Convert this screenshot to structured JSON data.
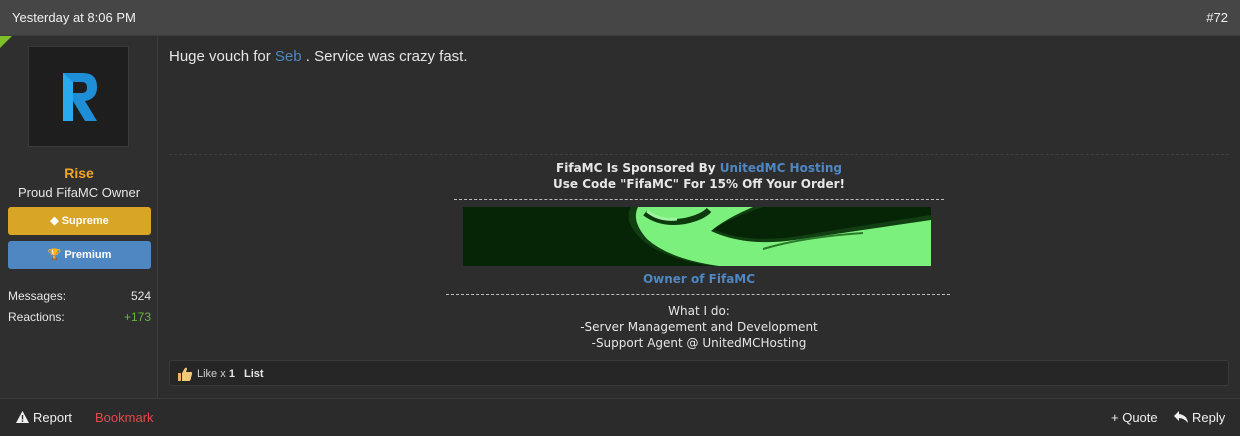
{
  "header": {
    "date": "Yesterday at 8:06 PM",
    "post_number": "#72"
  },
  "user": {
    "avatar_icon": "r-logo-icon",
    "name": "Rise",
    "title": "Proud FifaMC Owner",
    "badges": [
      {
        "label": "Supreme",
        "icon": "diamond-icon",
        "color": "#d9a526"
      },
      {
        "label": "Premium",
        "icon": "trophy-icon",
        "color": "#4f87c2"
      }
    ],
    "stats": {
      "messages_label": "Messages:",
      "messages_value": "524",
      "reactions_label": "Reactions:",
      "reactions_value": "+173"
    }
  },
  "message": {
    "before": "Huge vouch for",
    "mention": "Seb",
    "after": ". Service was crazy fast."
  },
  "signature": {
    "line1_text": "FifaMC Is Sponsored By",
    "line1_link": "UnitedMC Hosting",
    "line2": "Use Code \"FifaMC\" For 15% Off Your Order!",
    "owner": "Owner of FifaMC",
    "whatido": "What I do:",
    "item1": "-Server Management and Development",
    "item2": "-Support Agent @ UnitedMCHosting"
  },
  "likes": {
    "icon": "thumbs-up-icon",
    "prefix": "Like x",
    "count": "1",
    "list_label": "List"
  },
  "footer": {
    "report": "Report",
    "bookmark": "Bookmark",
    "quote": "+ Quote",
    "reply": "Reply"
  },
  "colors": {
    "accent_blue": "#4f87c2",
    "username": "#f5a623",
    "positive": "#63b83a",
    "bookmark": "#e04a4a"
  }
}
